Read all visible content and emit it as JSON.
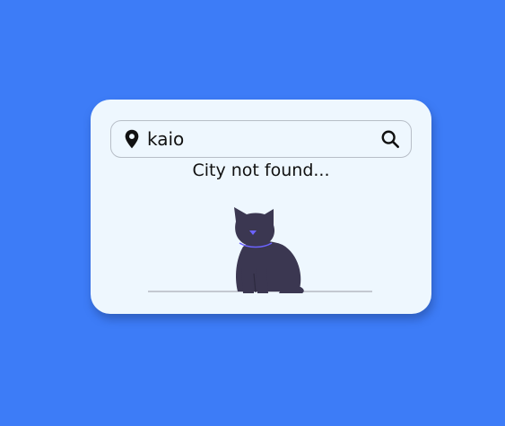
{
  "search": {
    "value": "kaio",
    "location_icon": "map-pin-icon",
    "search_icon": "magnifier-icon"
  },
  "status": {
    "message": "City not found..."
  },
  "illustration": {
    "subject": "cat-sitting",
    "cat_color": "#3b3751",
    "collar_color": "#6c63ff"
  },
  "colors": {
    "background": "#3d7cf7",
    "card": "#eef7fe"
  }
}
